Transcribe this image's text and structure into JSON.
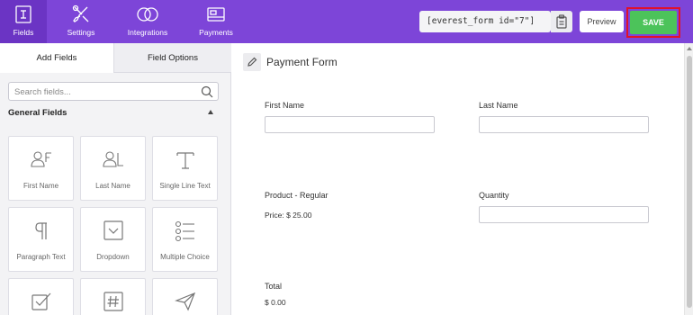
{
  "nav": {
    "items": [
      {
        "label": "Fields",
        "icon": "fields-icon",
        "active": true
      },
      {
        "label": "Settings",
        "icon": "settings-icon"
      },
      {
        "label": "Integrations",
        "icon": "integrations-icon"
      },
      {
        "label": "Payments",
        "icon": "payments-icon"
      }
    ]
  },
  "toolbar": {
    "shortcode": "[everest_form id=\"7\"]",
    "preview_label": "Preview",
    "save_label": "SAVE"
  },
  "sidebar": {
    "tabs": [
      {
        "label": "Add Fields",
        "active": true
      },
      {
        "label": "Field Options",
        "active": false
      }
    ],
    "search_placeholder": "Search fields...",
    "group_title": "General Fields",
    "fields": [
      {
        "label": "First Name",
        "icon": "first-name-icon"
      },
      {
        "label": "Last Name",
        "icon": "last-name-icon"
      },
      {
        "label": "Single Line Text",
        "icon": "single-line-text-icon"
      },
      {
        "label": "Paragraph Text",
        "icon": "paragraph-text-icon"
      },
      {
        "label": "Dropdown",
        "icon": "dropdown-icon"
      },
      {
        "label": "Multiple Choice",
        "icon": "multiple-choice-icon"
      },
      {
        "label": "",
        "icon": "checkbox-icon"
      },
      {
        "label": "",
        "icon": "number-icon"
      },
      {
        "label": "",
        "icon": "send-icon"
      }
    ]
  },
  "form": {
    "title": "Payment Form",
    "first_name_label": "First Name",
    "last_name_label": "Last Name",
    "product_label": "Product - Regular",
    "price_text": "Price: $ 25.00",
    "quantity_label": "Quantity",
    "total_label": "Total",
    "total_value": "$ 0.00"
  },
  "colors": {
    "topbar": "#7d45d8",
    "topbar_active": "#6b34c4",
    "save_green": "#4cc35a",
    "highlight_red": "#e0112b"
  }
}
